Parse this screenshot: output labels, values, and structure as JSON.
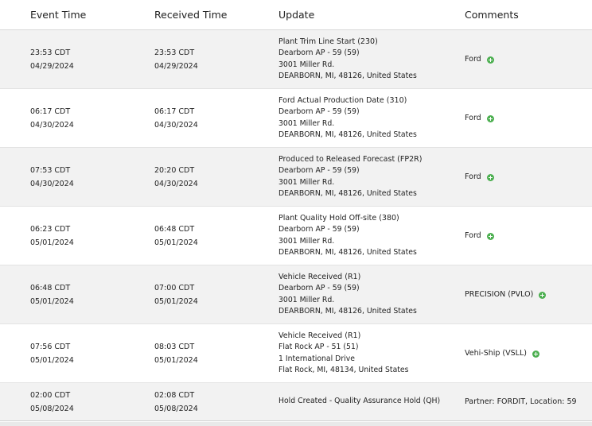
{
  "headers": {
    "event_time": "Event Time",
    "received_time": "Received Time",
    "update": "Update",
    "comments": "Comments"
  },
  "rows": [
    {
      "event_time": "23:53 CDT",
      "event_date": "04/29/2024",
      "received_time": "23:53 CDT",
      "received_date": "04/29/2024",
      "update_title": "Plant Trim Line Start  (230)",
      "update_location": "Dearborn AP - 59 (59)",
      "update_address": "3001 Miller Rd.",
      "update_city": "DEARBORN, MI, 48126, United States",
      "comment": "Ford",
      "has_add": true
    },
    {
      "event_time": "06:17 CDT",
      "event_date": "04/30/2024",
      "received_time": "06:17 CDT",
      "received_date": "04/30/2024",
      "update_title": "Ford Actual Production Date  (310)",
      "update_location": "Dearborn AP - 59 (59)",
      "update_address": "3001 Miller Rd.",
      "update_city": "DEARBORN, MI, 48126, United States",
      "comment": "Ford",
      "has_add": true
    },
    {
      "event_time": "07:53 CDT",
      "event_date": "04/30/2024",
      "received_time": "20:20 CDT",
      "received_date": "04/30/2024",
      "update_title": "Produced to Released Forecast  (FP2R)",
      "update_location": "Dearborn AP - 59 (59)",
      "update_address": "3001 Miller Rd.",
      "update_city": "DEARBORN, MI, 48126, United States",
      "comment": "Ford",
      "has_add": true
    },
    {
      "event_time": "06:23 CDT",
      "event_date": "05/01/2024",
      "received_time": "06:48 CDT",
      "received_date": "05/01/2024",
      "update_title": "Plant Quality Hold Off-site  (380)",
      "update_location": "Dearborn AP - 59 (59)",
      "update_address": "3001 Miller Rd.",
      "update_city": "DEARBORN, MI, 48126, United States",
      "comment": "Ford",
      "has_add": true
    },
    {
      "event_time": "06:48 CDT",
      "event_date": "05/01/2024",
      "received_time": "07:00 CDT",
      "received_date": "05/01/2024",
      "update_title": "Vehicle Received  (R1)",
      "update_location": "Dearborn AP - 59 (59)",
      "update_address": "3001 Miller Rd.",
      "update_city": "DEARBORN, MI, 48126, United States",
      "comment": "PRECISION (PVLO)",
      "has_add": true
    },
    {
      "event_time": "07:56 CDT",
      "event_date": "05/01/2024",
      "received_time": "08:03 CDT",
      "received_date": "05/01/2024",
      "update_title": "Vehicle Received  (R1)",
      "update_location": "Flat Rock AP - 51 (51)",
      "update_address": "1 International Drive",
      "update_city": "Flat Rock, MI, 48134, United States",
      "comment": "Vehi-Ship (VSLL)",
      "has_add": true
    },
    {
      "event_time": "02:00 CDT",
      "event_date": "05/08/2024",
      "received_time": "02:08 CDT",
      "received_date": "05/08/2024",
      "update_title": "Hold Created - Quality Assurance Hold (QH)",
      "comment": "Partner: FORDIT, Location: 59",
      "has_add": false
    }
  ]
}
